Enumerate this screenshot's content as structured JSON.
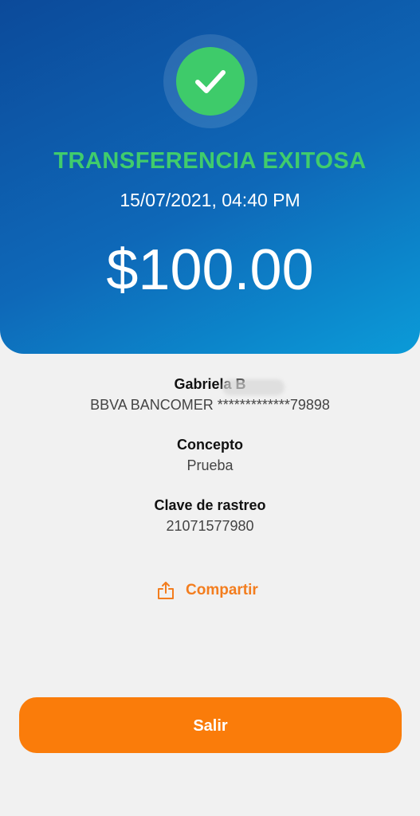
{
  "header": {
    "status_title": "TRANSFERENCIA EXITOSA",
    "datetime": "15/07/2021, 04:40 PM",
    "amount": "$100.00",
    "status_icon": "checkmark-icon"
  },
  "recipient": {
    "name": "Gabriela B",
    "account": "BBVA BANCOMER *************79898"
  },
  "concept": {
    "label": "Concepto",
    "value": "Prueba"
  },
  "tracking": {
    "label": "Clave de rastreo",
    "value": "21071577980"
  },
  "actions": {
    "share_label": "Compartir",
    "share_icon": "share-icon",
    "exit_label": "Salir"
  },
  "colors": {
    "success_green": "#40cc6c",
    "accent_orange": "#fa7c0a",
    "header_blue_start": "#0c4a9a",
    "header_blue_end": "#0b9bd8",
    "background": "#f1f1f1"
  }
}
